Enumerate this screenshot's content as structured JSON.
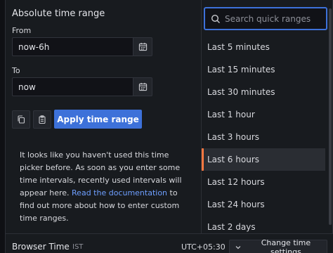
{
  "absolute": {
    "title": "Absolute time range",
    "from_label": "From",
    "from_value": "now-6h",
    "to_label": "To",
    "to_value": "now",
    "apply_label": "Apply time range"
  },
  "help": {
    "text": "It looks like you haven't used this time picker before. As soon as you enter some time intervals, recently used intervals will appear here.",
    "link": "Read the documentation",
    "after": " to find out more about how to enter custom time ranges."
  },
  "search": {
    "placeholder": "Search quick ranges"
  },
  "ranges": [
    "Last 5 minutes",
    "Last 15 minutes",
    "Last 30 minutes",
    "Last 1 hour",
    "Last 3 hours",
    "Last 6 hours",
    "Last 12 hours",
    "Last 24 hours",
    "Last 2 days"
  ],
  "active_range": "Last 6 hours",
  "footer": {
    "tz_label": "Browser Time",
    "tz_abbr": "IST",
    "tz_offset": "UTC+05:30",
    "change_label": "Change time settings"
  },
  "colors": {
    "accent": "#3d71d9",
    "active_marker": "#ff7941",
    "link": "#6e9fff"
  },
  "icons": {
    "calendar": "calendar-icon",
    "copy": "copy-icon",
    "paste": "clipboard-icon",
    "search": "search-icon",
    "chevron": "chevron-down-icon"
  }
}
